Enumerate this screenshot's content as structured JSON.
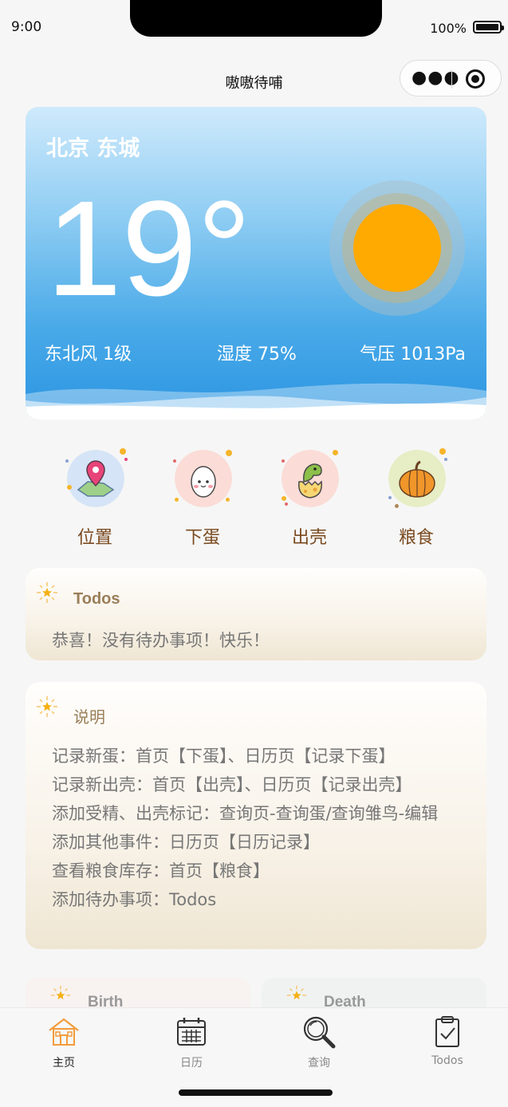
{
  "status_bar": {
    "time": "9:00",
    "battery_percent": "100%"
  },
  "nav": {
    "title": "嗷嗷待哺"
  },
  "weather": {
    "location": "北京 东城",
    "temperature": "19°",
    "wind": "东北风 1级",
    "humidity": "湿度 75%",
    "pressure": "气压 1013Pa"
  },
  "quick_actions": [
    {
      "label": "位置",
      "icon": "map-pin-icon"
    },
    {
      "label": "下蛋",
      "icon": "egg-icon"
    },
    {
      "label": "出壳",
      "icon": "hatching-dino-icon"
    },
    {
      "label": "粮食",
      "icon": "pumpkin-icon"
    }
  ],
  "todos": {
    "title": "Todos",
    "empty_text": "恭喜！没有待办事项！快乐！"
  },
  "notes": {
    "title": "说明",
    "lines": [
      "记录新蛋：首页【下蛋】、日历页【记录下蛋】",
      "记录新出壳：首页【出壳】、日历页【记录出壳】",
      "添加受精、出壳标记：查询页-查询蛋/查询雏鸟-编辑",
      "添加其他事件：日历页【日历记录】",
      "查看粮食库存：首页【粮食】",
      "添加待办事项：Todos"
    ]
  },
  "mini_cards": {
    "birth": "Birth",
    "death": "Death"
  },
  "tabbar": [
    {
      "label": "主页",
      "icon": "home-icon",
      "active": true
    },
    {
      "label": "日历",
      "icon": "calendar-icon",
      "active": false
    },
    {
      "label": "查询",
      "icon": "search-icon",
      "active": false
    },
    {
      "label": "Todos",
      "icon": "clipboard-check-icon",
      "active": false
    }
  ],
  "colors": {
    "sun": "#ffaa00",
    "accent": "#f39c3c",
    "label_brown": "#7a4a20"
  }
}
